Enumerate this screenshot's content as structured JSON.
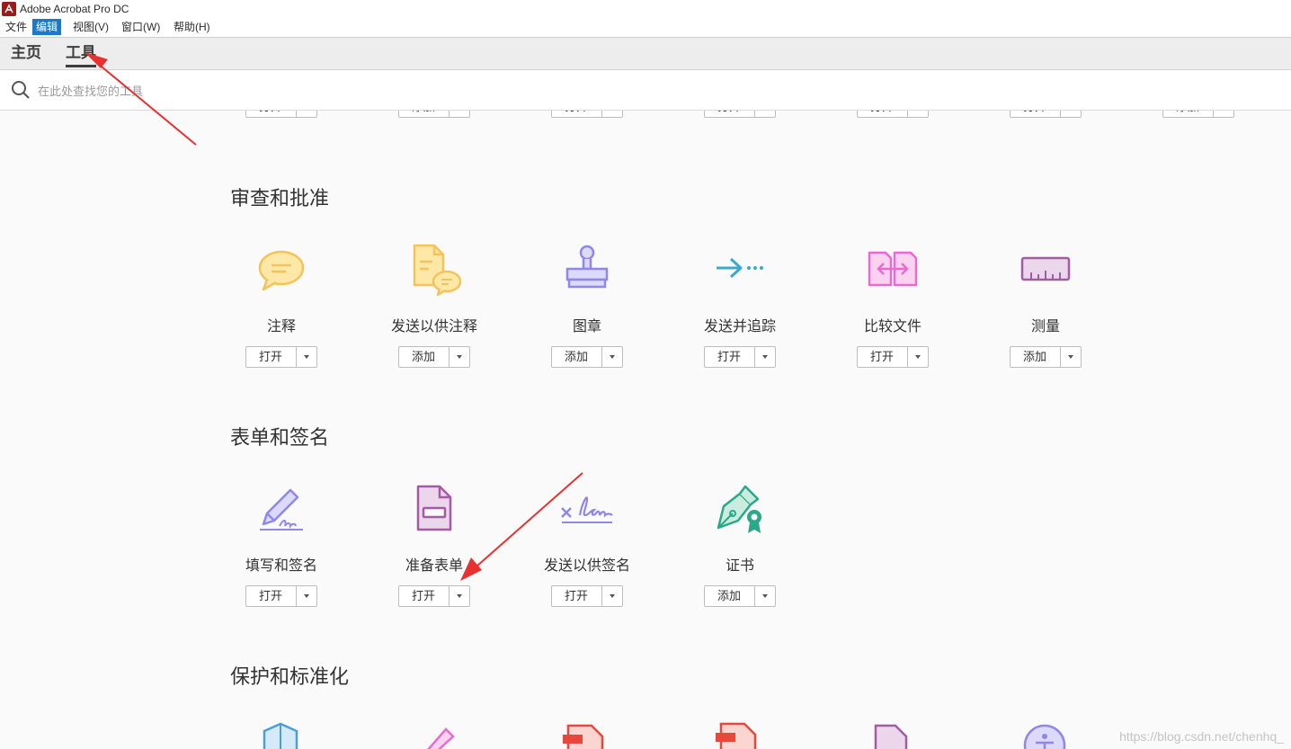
{
  "window": {
    "title": "Adobe Acrobat Pro DC"
  },
  "menubar": {
    "items": [
      {
        "label": "文件",
        "active": false
      },
      {
        "label": "编辑",
        "active": true
      },
      {
        "label": "视图(V)",
        "active": false
      },
      {
        "label": "窗口(W)",
        "active": false
      },
      {
        "label": "帮助(H)",
        "active": false
      }
    ]
  },
  "tabs": [
    {
      "label": "主页",
      "selected": false
    },
    {
      "label": "工具",
      "selected": true
    }
  ],
  "search": {
    "placeholder": "在此处查找您的工具"
  },
  "top_row_buttons": [
    "打开",
    "添加",
    "打开",
    "打开",
    "打开",
    "打开",
    "添加"
  ],
  "sections": [
    {
      "title": "审查和批准",
      "tools": [
        {
          "name": "注释",
          "button": "打开",
          "icon": "speech-bubble-icon"
        },
        {
          "name": "发送以供注释",
          "button": "添加",
          "icon": "document-comment-icon"
        },
        {
          "name": "图章",
          "button": "添加",
          "icon": "stamp-icon"
        },
        {
          "name": "发送并追踪",
          "button": "打开",
          "icon": "arrow-track-icon"
        },
        {
          "name": "比较文件",
          "button": "打开",
          "icon": "compare-files-icon"
        },
        {
          "name": "测量",
          "button": "添加",
          "icon": "ruler-icon"
        }
      ]
    },
    {
      "title": "表单和签名",
      "tools": [
        {
          "name": "填写和签名",
          "button": "打开",
          "icon": "pen-sign-icon"
        },
        {
          "name": "准备表单",
          "button": "打开",
          "icon": "form-document-icon"
        },
        {
          "name": "发送以供签名",
          "button": "打开",
          "icon": "signature-line-icon"
        },
        {
          "name": "证书",
          "button": "添加",
          "icon": "certificate-pen-icon"
        }
      ]
    },
    {
      "title": "保护和标准化",
      "tools": []
    }
  ],
  "watermark": "https://blog.csdn.net/chenhq_",
  "colors": {
    "accent": "#1979ca",
    "arrow": "#e8312f",
    "yellow": "#f5c35c",
    "purple": "#8f87ea",
    "teal": "#3da9c9",
    "pink": "#e86bd0",
    "plum": "#a35ca3",
    "green": "#2aa887"
  }
}
